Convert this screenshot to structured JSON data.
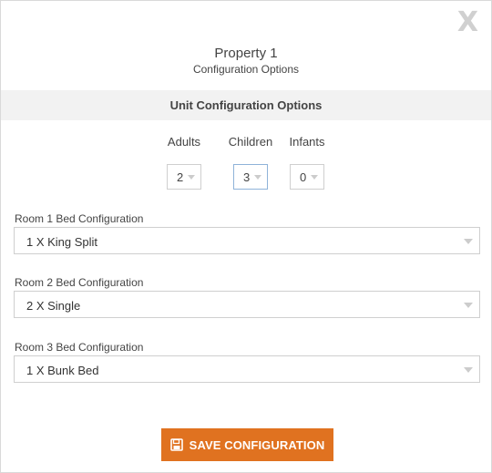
{
  "header": {
    "close_glyph": "X",
    "title": "Property 1",
    "subtitle": "Configuration Options"
  },
  "section": {
    "title": "Unit Configuration Options"
  },
  "occupancy": {
    "adults": {
      "label": "Adults",
      "value": "2"
    },
    "children": {
      "label": "Children",
      "value": "3"
    },
    "infants": {
      "label": "Infants",
      "value": "0"
    }
  },
  "rooms": [
    {
      "label": "Room 1 Bed Configuration",
      "value": "1 X King Split"
    },
    {
      "label": "Room 2 Bed Configuration",
      "value": "2 X Single"
    },
    {
      "label": "Room 3 Bed Configuration",
      "value": "1 X Bunk Bed"
    }
  ],
  "actions": {
    "save_label": "SAVE CONFIGURATION",
    "save_icon": "floppy-disk-icon"
  },
  "colors": {
    "accent": "#e07220",
    "section_bg": "#f2f2f2",
    "focus_border": "#8fb3d9"
  }
}
